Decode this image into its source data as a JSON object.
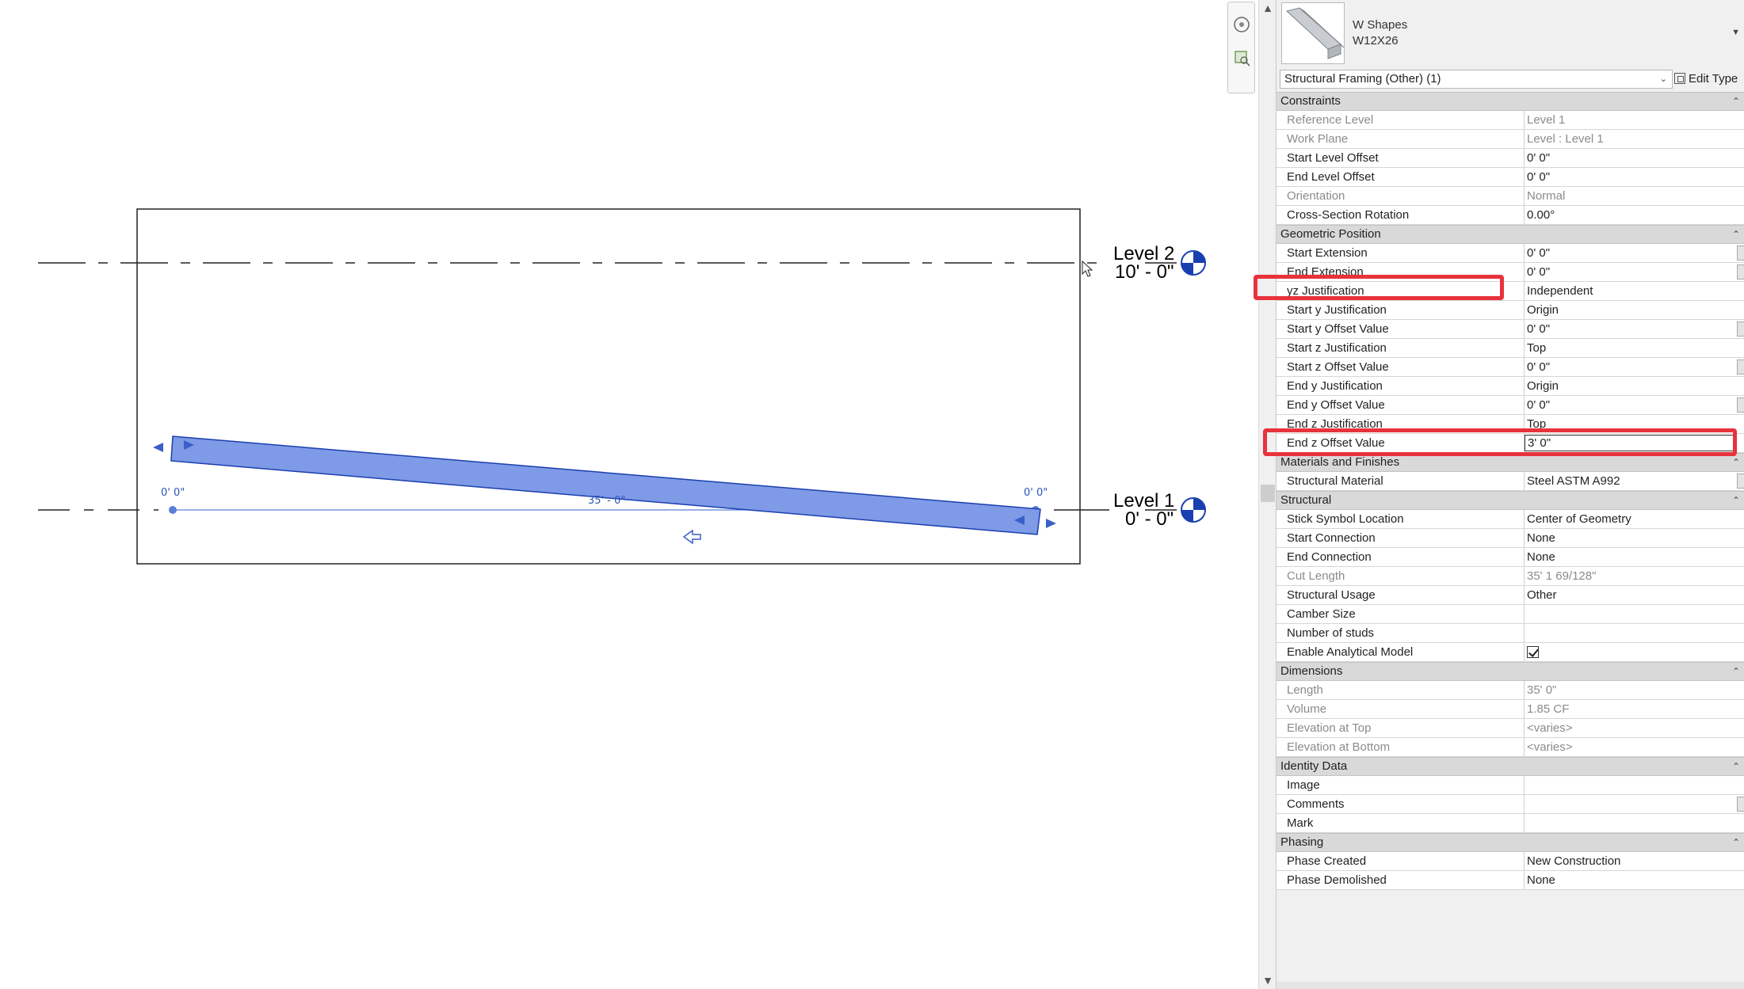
{
  "canvas": {
    "levels": [
      {
        "name": "Level 2",
        "elevation": "10' - 0\""
      },
      {
        "name": "Level 1",
        "elevation": "0' - 0\""
      }
    ],
    "dims": {
      "left_offset": "0'  0\"",
      "right_offset": "0'  0\"",
      "length": "35' - 0\""
    },
    "beam_color": "#7f9ae6"
  },
  "type": {
    "family": "W Shapes",
    "name": "W12X26"
  },
  "selector": {
    "value": "Structural Framing (Other) (1)",
    "edit_type_label": "Edit Type"
  },
  "groups": [
    {
      "title": "Constraints",
      "rows": [
        {
          "name": "Reference Level",
          "value": "Level 1",
          "readonly": true
        },
        {
          "name": "Work Plane",
          "value": "Level : Level 1",
          "readonly": true
        },
        {
          "name": "Start Level Offset",
          "value": "0'  0\""
        },
        {
          "name": "End Level Offset",
          "value": "0'  0\""
        },
        {
          "name": "Orientation",
          "value": "Normal",
          "readonly": true
        },
        {
          "name": "Cross-Section Rotation",
          "value": "0.00°"
        }
      ]
    },
    {
      "title": "Geometric Position",
      "rows": [
        {
          "name": "Start Extension",
          "value": "0'  0\"",
          "button": true
        },
        {
          "name": "End Extension",
          "value": "0'  0\"",
          "button": true
        },
        {
          "name": "yz Justification",
          "value": "Independent",
          "highlighted": true
        },
        {
          "name": "Start y Justification",
          "value": "Origin"
        },
        {
          "name": "Start y Offset Value",
          "value": "0'  0\"",
          "button": true
        },
        {
          "name": "Start z Justification",
          "value": "Top"
        },
        {
          "name": "Start z Offset Value",
          "value": "0'  0\"",
          "button": true
        },
        {
          "name": "End y Justification",
          "value": "Origin"
        },
        {
          "name": "End y Offset Value",
          "value": "0'  0\"",
          "button": true
        },
        {
          "name": "End z Justification",
          "value": "Top"
        },
        {
          "name": "End z Offset Value",
          "value": "3'  0\"",
          "editing": true,
          "highlighted": true
        }
      ]
    },
    {
      "title": "Materials and Finishes",
      "rows": [
        {
          "name": "Structural Material",
          "value": "Steel ASTM A992",
          "button": true
        }
      ]
    },
    {
      "title": "Structural",
      "rows": [
        {
          "name": "Stick Symbol Location",
          "value": "Center of Geometry"
        },
        {
          "name": "Start Connection",
          "value": "None"
        },
        {
          "name": "End Connection",
          "value": "None"
        },
        {
          "name": "Cut Length",
          "value": "35'  1 69/128\"",
          "readonly": true
        },
        {
          "name": "Structural Usage",
          "value": "Other"
        },
        {
          "name": "Camber Size",
          "value": ""
        },
        {
          "name": "Number of studs",
          "value": ""
        },
        {
          "name": "Enable Analytical Model",
          "value": "",
          "checkbox": true
        }
      ]
    },
    {
      "title": "Dimensions",
      "rows": [
        {
          "name": "Length",
          "value": "35'  0\"",
          "readonly": true
        },
        {
          "name": "Volume",
          "value": "1.85 CF",
          "readonly": true
        },
        {
          "name": "Elevation at Top",
          "value": "<varies>",
          "readonly": true
        },
        {
          "name": "Elevation at Bottom",
          "value": "<varies>",
          "readonly": true
        }
      ]
    },
    {
      "title": "Identity Data",
      "rows": [
        {
          "name": "Image",
          "value": ""
        },
        {
          "name": "Comments",
          "value": "",
          "button": true
        },
        {
          "name": "Mark",
          "value": ""
        }
      ]
    },
    {
      "title": "Phasing",
      "rows": [
        {
          "name": "Phase Created",
          "value": "New Construction"
        },
        {
          "name": "Phase Demolished",
          "value": "None"
        }
      ]
    }
  ],
  "accent": {
    "highlight": "#e8323c",
    "selection": "#2a55b8"
  }
}
